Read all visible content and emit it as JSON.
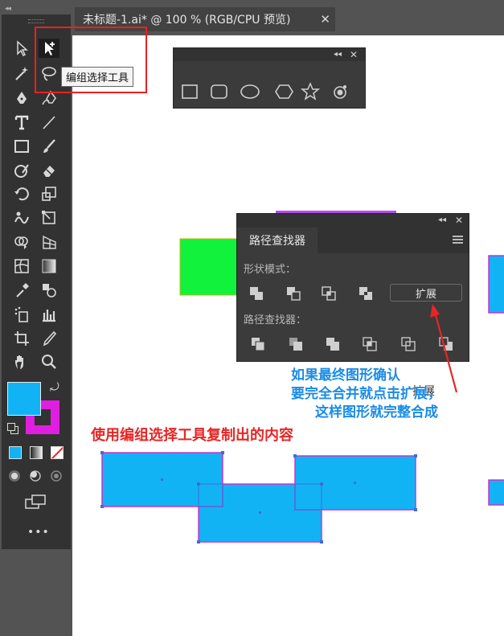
{
  "document_tab": {
    "title": "未标题-1.ai* @ 100 % (RGB/CPU 预览)",
    "close": "✕"
  },
  "toolbar": {
    "collapse": "◂◂",
    "tooltip": "编组选择工具",
    "icons": [
      "direct-selection",
      "group-selection",
      "magic-wand",
      "lasso",
      "pen",
      "curvature",
      "type",
      "line",
      "rectangle",
      "paintbrush",
      "shaper",
      "eraser",
      "rotate",
      "scale",
      "warp",
      "free-transform",
      "shape-builder",
      "perspective-grid",
      "mesh",
      "gradient",
      "eyedropper",
      "blend",
      "symbol-sprayer",
      "column-graph",
      "artboard",
      "slice",
      "hand",
      "zoom"
    ],
    "fill_color": "#12b3f5",
    "stroke_color": "#e01ee0",
    "more": "•••"
  },
  "shapes_panel": {
    "collapse": "◂◂",
    "close": "✕",
    "shapes": [
      "rectangle",
      "rounded-rectangle",
      "ellipse",
      "polygon",
      "star",
      "flare"
    ]
  },
  "pathfinder_panel": {
    "collapse": "◂◂",
    "close": "✕",
    "tab": "路径查找器",
    "shape_modes_label": "形状模式：",
    "expand_label": "扩展",
    "pathfinders_label": "路径查找器："
  },
  "annotations": {
    "blue_line1": "如果最终图形确认",
    "blue_line2": "要完全合并就点击扩展，",
    "blue_line3": "这样图形就完整合成",
    "red_note": "使用编组选择工具复制出的内容",
    "cursor_tooltip": "扩展"
  },
  "colors": {
    "shape_fill": "#12b3f5",
    "shape_stroke": "#cc33cc",
    "green_rect": "#11f23c",
    "accent_red": "#ee2020",
    "accent_blue": "#1a8be6"
  }
}
